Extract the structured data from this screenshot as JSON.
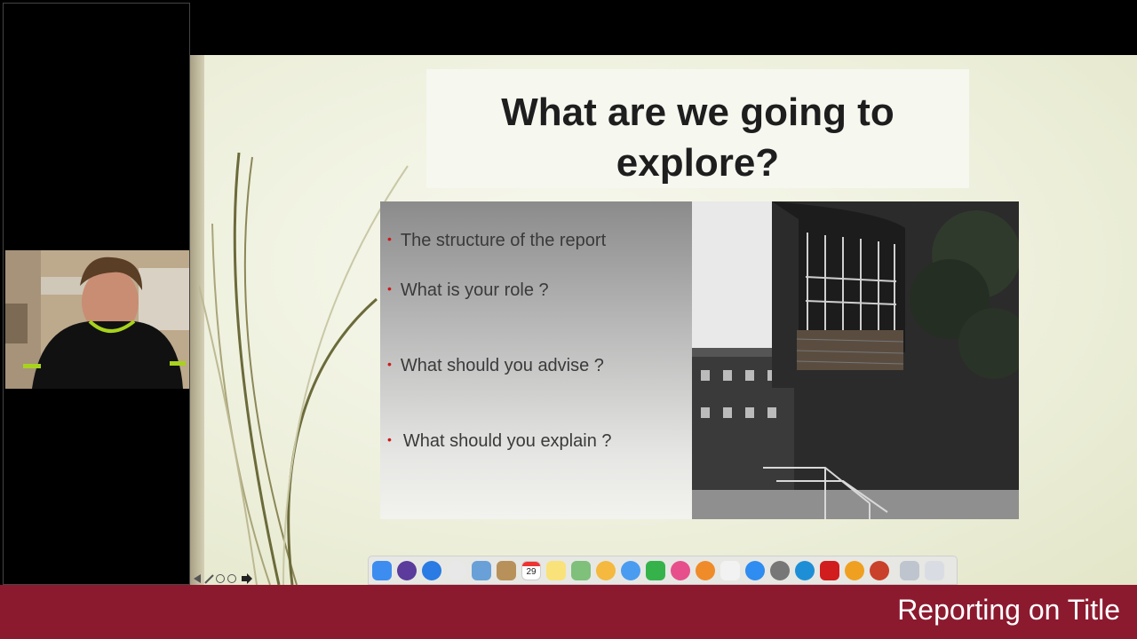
{
  "slide": {
    "title_line1": "What are we going to",
    "title_line2": "explore?",
    "bullets": [
      "The structure of the report",
      "What is your role ?",
      "What should you advise ?",
      "What should you explain ?"
    ],
    "bullet_marker": "•"
  },
  "dock": {
    "calendar_day": "29",
    "icons": [
      "finder-icon",
      "siri-icon",
      "safari-icon",
      "chrome-icon",
      "preview-icon",
      "contacts-icon",
      "calendar-icon",
      "notes-icon",
      "maps-icon",
      "photos-icon",
      "messages-icon",
      "facetime-icon",
      "itunes-icon",
      "ibooks-icon",
      "reminders-icon",
      "app-store-icon",
      "system-preferences-icon",
      "skype-icon",
      "acrobat-icon",
      "plugin-icon",
      "powerpoint-icon",
      "downloads-icon",
      "trash-icon"
    ],
    "colors": [
      "#3d8cf0",
      "#5b3b9c",
      "#2a7be4",
      "#e8e8e8",
      "#6aa0d8",
      "#b8915a",
      "#ffffff",
      "#f9e27a",
      "#7fc07a",
      "#f4b93e",
      "#4a9cf0",
      "#35b34a",
      "#e64f8c",
      "#f08b2a",
      "#f2f2f2",
      "#2f8cf0",
      "#777777",
      "#1e8fd6",
      "#d11d1d",
      "#f0a020",
      "#c9412b",
      "#bfc5cf",
      "#d9dde3"
    ]
  },
  "footer": {
    "title": "Reporting on Title"
  }
}
